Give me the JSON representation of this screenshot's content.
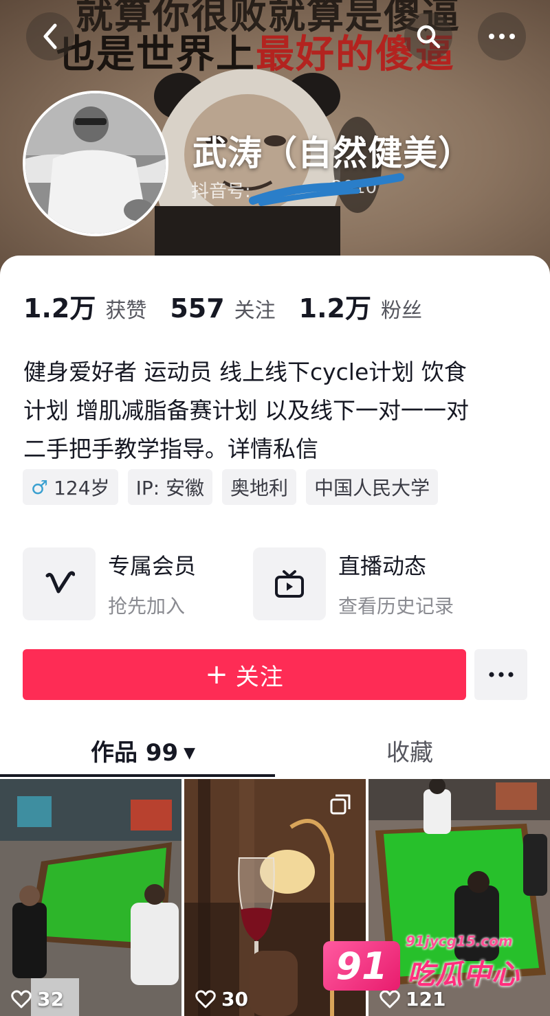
{
  "banner": {
    "meme_line_top": "就算你很败就算是傻逼",
    "meme_line_main": "也是世界上",
    "meme_line_red": "最好的傻逼"
  },
  "profile": {
    "nickname": "武涛（自然健美）",
    "douyin_id_label": "抖音号: ",
    "douyin_id_visible_suffix": "2010"
  },
  "stats": [
    {
      "value": "1.2万",
      "label": "获赞"
    },
    {
      "value": "557",
      "label": "关注"
    },
    {
      "value": "1.2万",
      "label": "粉丝"
    }
  ],
  "bio": {
    "line1": "健身爱好者 运动员 线上线下cycle计划 饮食",
    "line2": "计划 增肌减脂备赛计划 以及线下一对一一对",
    "line3": "二手把手教学指导。详情私信"
  },
  "tags": {
    "gender_symbol": "♂",
    "age": "124岁",
    "ip": "IP: 安徽",
    "location": "奥地利",
    "school": "中国人民大学"
  },
  "cards": {
    "member": {
      "title": "专属会员",
      "subtitle": "抢先加入"
    },
    "live": {
      "title": "直播动态",
      "subtitle": "查看历史记录"
    }
  },
  "actions": {
    "follow_plus": "+",
    "follow_label": "关注"
  },
  "tabs": {
    "works_label": "作品 99",
    "works_caret": "▼",
    "favorites_label": "收藏"
  },
  "posts": [
    {
      "likes": "32"
    },
    {
      "likes": "30"
    },
    {
      "likes": "121"
    }
  ],
  "watermark": {
    "logo_number": "91",
    "url": "91jycg15.com",
    "text": "吃瓜中心"
  },
  "colors": {
    "accent": "#fe2c55",
    "male": "#3aa0d0",
    "tag_bg": "#f2f2f4"
  }
}
